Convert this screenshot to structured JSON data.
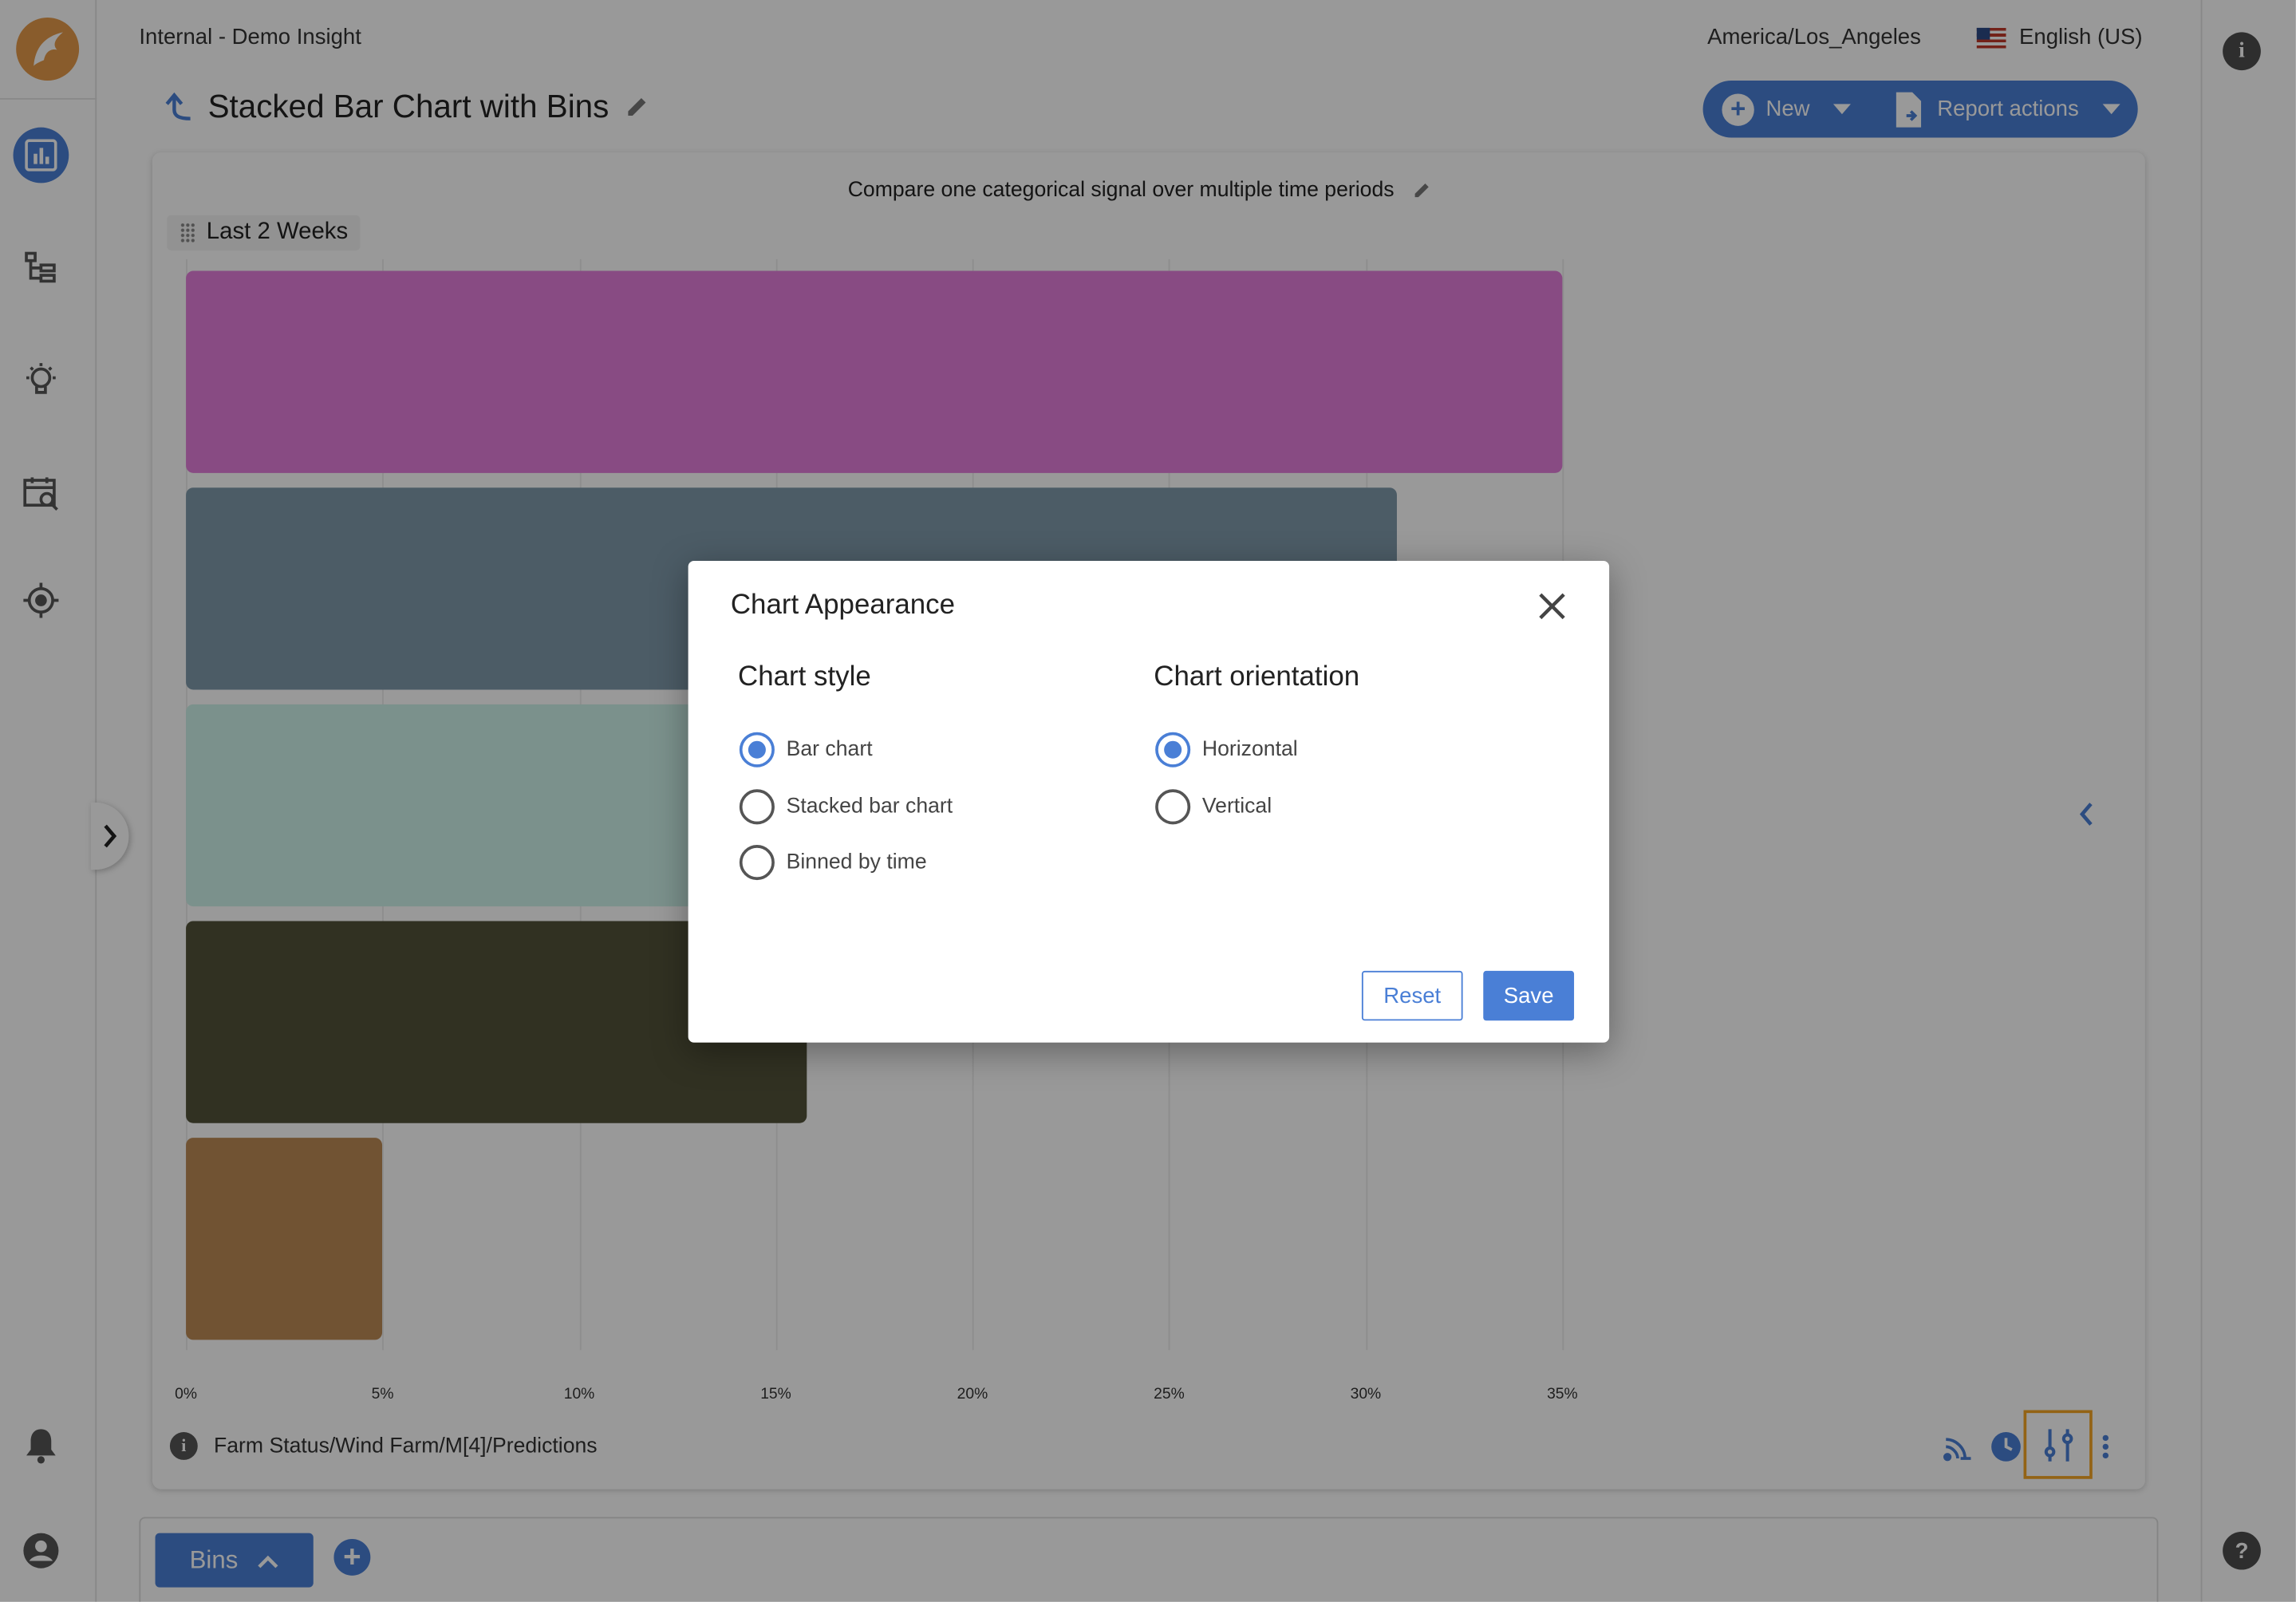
{
  "header": {
    "workspace": "Internal - Demo Insight",
    "timezone": "America/Los_Angeles",
    "language": "English (US)"
  },
  "page": {
    "title": "Stacked Bar Chart with Bins",
    "new_label": "New",
    "report_actions_label": "Report actions"
  },
  "chart_card": {
    "subtitle": "Compare one categorical signal over multiple time periods",
    "time_chip": "Last 2 Weeks",
    "signal_path": "Farm Status/Wind Farm/M[4]/Predictions"
  },
  "chart_data": {
    "type": "bar",
    "orientation": "horizontal",
    "x_tick_labels": [
      "0%",
      "5%",
      "10%",
      "15%",
      "20%",
      "25%",
      "30%",
      "35%"
    ],
    "xlim": [
      0,
      35
    ],
    "values": [
      35,
      30.8,
      23.4,
      15.8,
      5
    ],
    "colors": [
      "#e37edb",
      "#7f9aab",
      "#cdf2e9",
      "#52533a",
      "#bd8a55"
    ],
    "grid": true
  },
  "modal": {
    "title": "Chart Appearance",
    "style_heading": "Chart style",
    "style_options": [
      "Bar chart",
      "Stacked bar chart",
      "Binned by time"
    ],
    "style_selected": "Bar chart",
    "orientation_heading": "Chart orientation",
    "orientation_options": [
      "Horizontal",
      "Vertical"
    ],
    "orientation_selected": "Horizontal",
    "reset_label": "Reset",
    "save_label": "Save"
  },
  "bottom_bar": {
    "bins_label": "Bins"
  },
  "colors": {
    "accent": "#4a7fd6",
    "logo": "#e59a4a",
    "highlight": "#f5a623"
  },
  "icons": [
    "logo-icon",
    "analytics-icon",
    "hierarchy-icon",
    "lightbulb-icon",
    "calendar-search-icon",
    "target-icon",
    "bell-icon",
    "account-icon",
    "info-icon",
    "help-icon",
    "back-arrow-icon",
    "pencil-icon",
    "add-circle-icon",
    "report-file-icon",
    "feed-icon",
    "clock-icon",
    "sliders-icon",
    "more-vert-icon",
    "chevron-left-icon",
    "chevron-right-icon",
    "close-icon",
    "chevron-up-icon"
  ]
}
